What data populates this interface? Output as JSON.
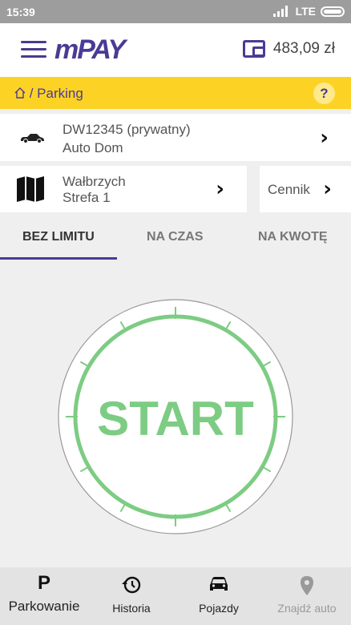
{
  "status_bar": {
    "time": "15:39",
    "network": "LTE"
  },
  "app_bar": {
    "logo": "mPAY",
    "balance": "483,09 zł"
  },
  "breadcrumb": {
    "path": "/ Parking",
    "help": "?"
  },
  "vehicle": {
    "plate": "DW12345 (prywatny)",
    "name": "Auto Dom"
  },
  "zone": {
    "city": "Wałbrzych",
    "zone": "Strefa 1"
  },
  "price_list": {
    "label": "Cennik"
  },
  "tabs": [
    {
      "label": "BEZ LIMITU",
      "active": true
    },
    {
      "label": "NA CZAS",
      "active": false
    },
    {
      "label": "NA KWOTĘ",
      "active": false
    }
  ],
  "start_button": {
    "label": "START",
    "color": "#7dcc83"
  },
  "bottom_nav": [
    {
      "label": "Parkowanie",
      "icon": "parking-icon"
    },
    {
      "label": "Historia",
      "icon": "history-icon"
    },
    {
      "label": "Pojazdy",
      "icon": "car-icon"
    },
    {
      "label": "Znajdź auto",
      "icon": "location-pin-icon",
      "disabled": true
    }
  ],
  "colors": {
    "accent": "#4b3a95",
    "breadcrumb_bg": "#fcd325",
    "start_green": "#7dcc83"
  }
}
